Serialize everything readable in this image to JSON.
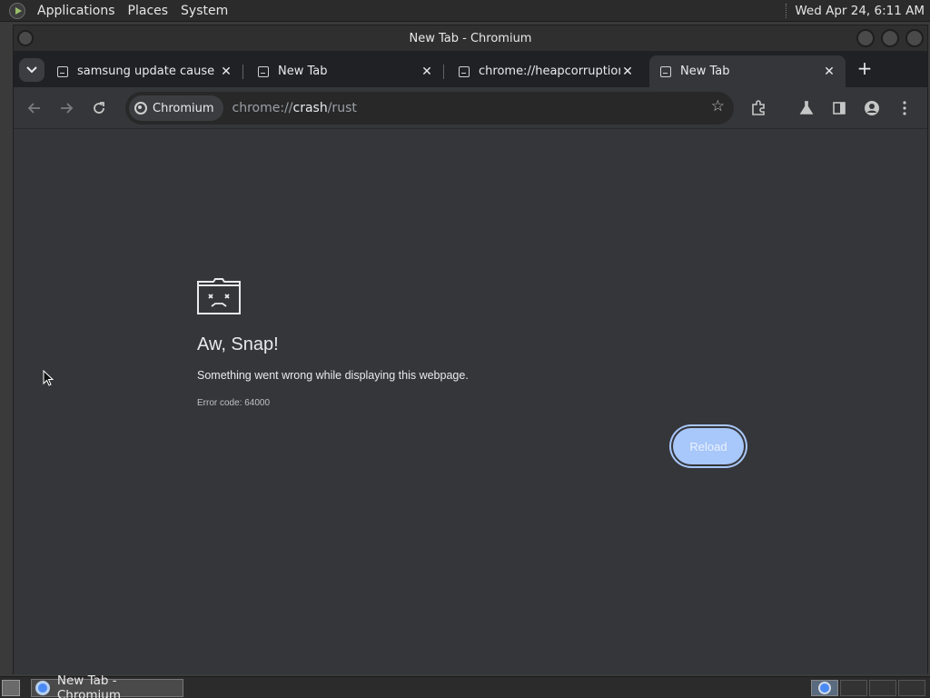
{
  "top_panel": {
    "menus": [
      "Applications",
      "Places",
      "System"
    ],
    "clock": "Wed Apr 24,  6:11 AM"
  },
  "window": {
    "title": "New Tab - Chromium"
  },
  "tabs": [
    {
      "label": "samsung update cause gr",
      "active": false
    },
    {
      "label": "New Tab",
      "active": false
    },
    {
      "label": "chrome://heapcorruptionc",
      "active": false
    },
    {
      "label": "New Tab",
      "active": true
    }
  ],
  "toolbar": {
    "site_chip": "Chromium",
    "url_prefix": "chrome://",
    "url_host": "crash",
    "url_path": "/rust"
  },
  "error_page": {
    "headline": "Aw, Snap!",
    "message": "Something went wrong while displaying this webpage.",
    "error_code": "Error code: 64000",
    "reload_label": "Reload"
  },
  "taskbar": {
    "task_label": "New Tab - Chromium"
  },
  "colors": {
    "accent": "#a8c7fa",
    "page_bg": "#35363a"
  }
}
